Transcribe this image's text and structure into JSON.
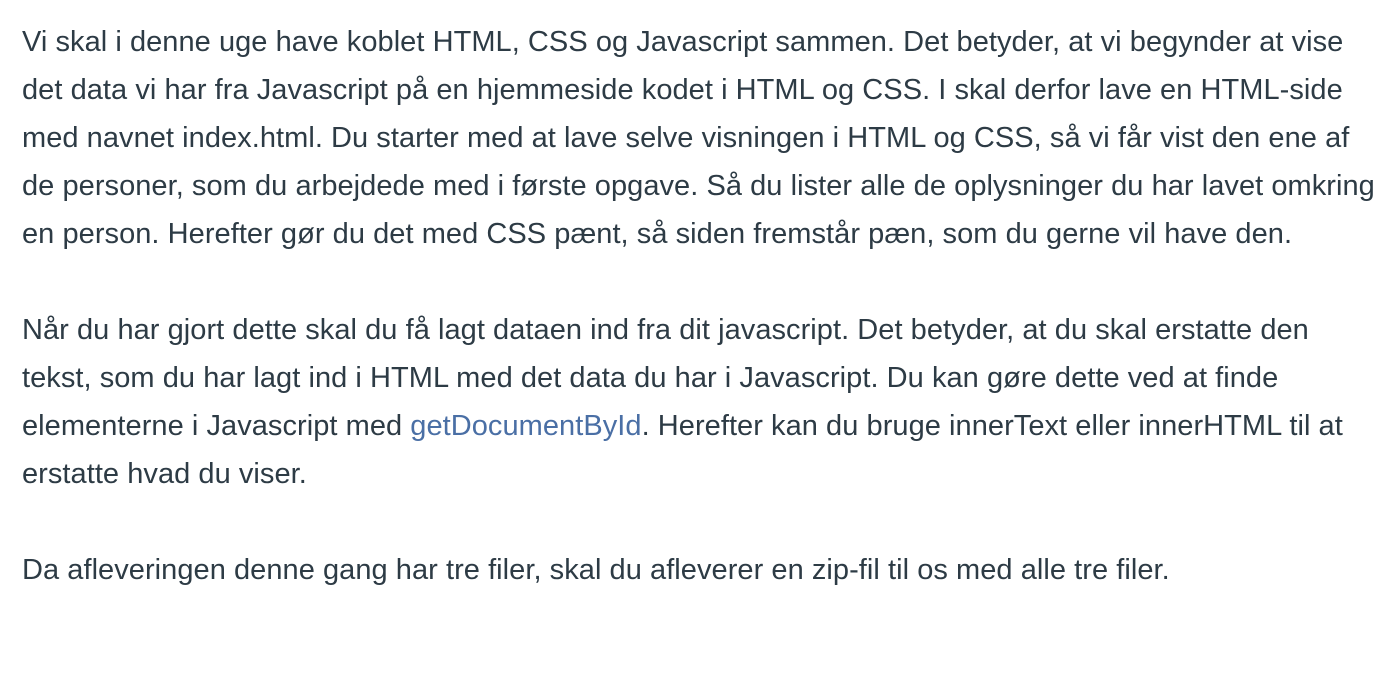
{
  "paragraphs": {
    "p1": "Vi skal i denne uge have koblet HTML, CSS og Javascript sammen. Det betyder, at vi begynder at vise det data vi har fra Javascript på en hjemmeside kodet i HTML og CSS. I skal derfor lave en HTML-side med navnet index.html. Du starter med at lave selve visningen i HTML og CSS, så vi får vist den ene af de personer, som du arbejdede med i første opgave. Så du lister alle de oplysninger du har lavet omkring en person. Herefter gør du det med CSS pænt, så siden fremstår pæn, som du gerne vil have den.",
    "p2_before": "Når du har gjort dette skal du få lagt dataen ind fra dit javascript. Det betyder, at du skal erstatte den tekst, som du har lagt ind i HTML med det data du har i Javascript. Du kan gøre dette ved at finde elementerne i Javascript med ",
    "p2_link": "getDocumentById",
    "p2_after": ". Herefter kan du bruge innerText eller innerHTML til at erstatte hvad du viser.",
    "p3": "Da afleveringen denne gang har tre filer, skal du afleverer en zip-fil til os med alle tre filer."
  },
  "colors": {
    "text": "#2d3b45",
    "link": "#4a6fa5",
    "background": "#ffffff"
  }
}
